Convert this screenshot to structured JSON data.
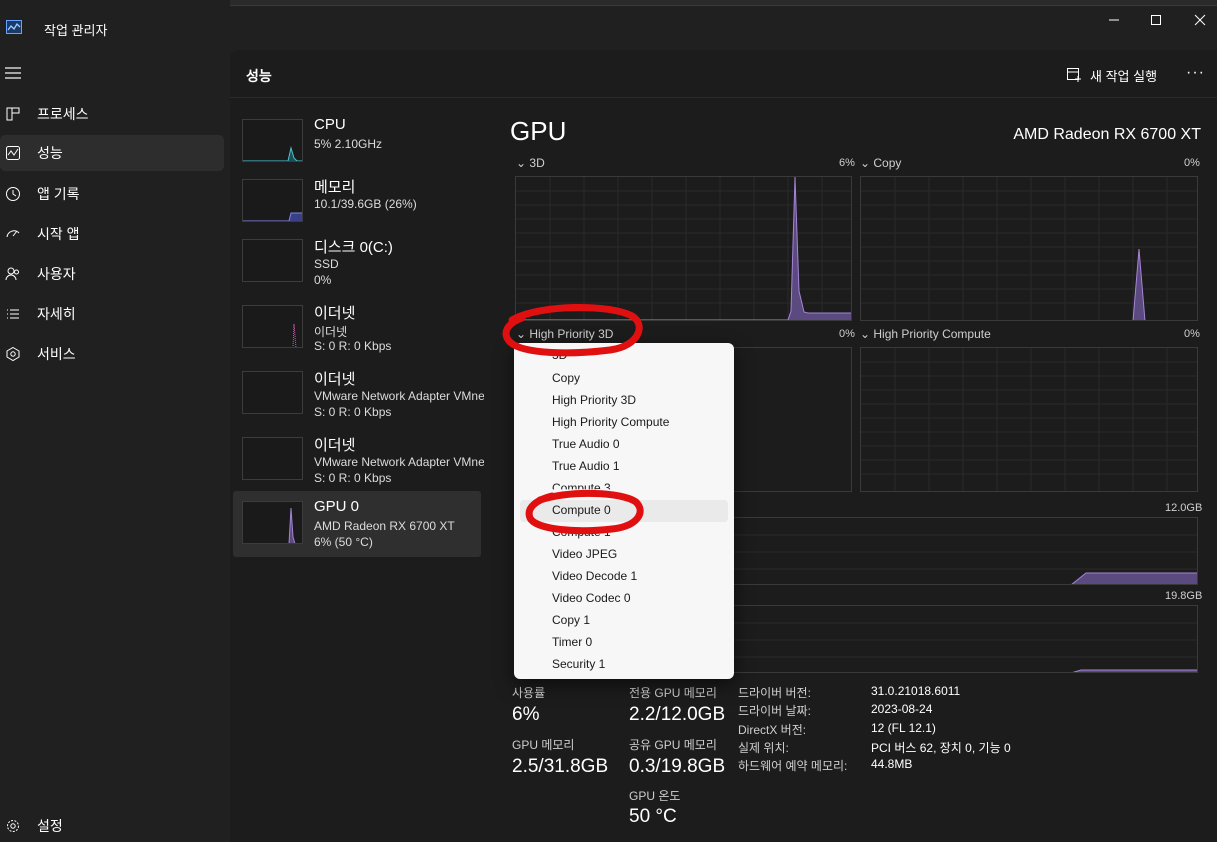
{
  "app": {
    "title": "작업 관리자"
  },
  "nav": {
    "items": [
      {
        "label": "프로세스",
        "icon": "processes-icon"
      },
      {
        "label": "성능",
        "icon": "performance-icon"
      },
      {
        "label": "앱 기록",
        "icon": "app-history-icon"
      },
      {
        "label": "시작 앱",
        "icon": "startup-apps-icon"
      },
      {
        "label": "사용자",
        "icon": "users-icon"
      },
      {
        "label": "자세히",
        "icon": "details-icon"
      },
      {
        "label": "서비스",
        "icon": "services-icon"
      }
    ],
    "settings_label": "설정"
  },
  "header": {
    "title": "성능",
    "new_task_label": "새 작업 실행",
    "more_label": "···"
  },
  "devices": [
    {
      "name": "CPU",
      "sub1": "5% 2.10GHz",
      "sub2": ""
    },
    {
      "name": "메모리",
      "sub1": "10.1/39.6GB (26%)",
      "sub2": ""
    },
    {
      "name": "디스크 0(C:)",
      "sub1": "SSD",
      "sub2": "0%"
    },
    {
      "name": "이더넷",
      "sub1": "이더넷",
      "sub2": "S: 0 R: 0 Kbps"
    },
    {
      "name": "이더넷",
      "sub1": "VMware Network Adapter VMnet",
      "sub2": "S: 0 R: 0 Kbps"
    },
    {
      "name": "이더넷",
      "sub1": "VMware Network Adapter VMnet",
      "sub2": "S: 0 R: 0 Kbps"
    },
    {
      "name": "GPU 0",
      "sub1": "AMD Radeon RX 6700 XT",
      "sub2": "6% (50 °C)"
    }
  ],
  "detail": {
    "title": "GPU",
    "model": "AMD Radeon RX 6700 XT",
    "engines": [
      {
        "label": "3D",
        "value": "6%"
      },
      {
        "label": "Copy",
        "value": "0%"
      },
      {
        "label": "High Priority 3D",
        "value": "0%"
      },
      {
        "label": "High Priority Compute",
        "value": "0%"
      }
    ],
    "dedicated_max": "12.0GB",
    "shared_max": "19.8GB"
  },
  "dropdown": {
    "options": [
      "3D",
      "Copy",
      "High Priority 3D",
      "High Priority Compute",
      "True Audio 0",
      "True Audio 1",
      "Compute 3",
      "Compute 0",
      "Compute 1",
      "Video JPEG",
      "Video Decode 1",
      "Video Codec 0",
      "Copy 1",
      "Timer 0",
      "Security 1"
    ]
  },
  "stats": {
    "usage_label": "사용률",
    "usage_value": "6%",
    "dedicated_label": "전용 GPU 메모리",
    "dedicated_value": "2.2/12.0GB",
    "gpumem_label": "GPU 메모리",
    "gpumem_value": "2.5/31.8GB",
    "shared_label": "공유 GPU 메모리",
    "shared_value": "0.3/19.8GB",
    "temp_label": "GPU 온도",
    "temp_value": "50 °C"
  },
  "info": [
    {
      "key": "드라이버 버전:",
      "value": "31.0.21018.6011"
    },
    {
      "key": "드라이버 날짜:",
      "value": "2023-08-24"
    },
    {
      "key": "DirectX 버전:",
      "value": "12 (FL 12.1)"
    },
    {
      "key": "실제 위치:",
      "value": "PCI 버스 62, 장치 0, 기능 0"
    },
    {
      "key": "하드웨어 예약 메모리:",
      "value": "44.8MB"
    }
  ],
  "colors": {
    "gpu_purple": "#a584d6",
    "cpu_teal": "#4cc2d2",
    "annotation_red": "#e01010",
    "memory_blue": "#7f86e8",
    "network_pink": "#c063a8"
  }
}
